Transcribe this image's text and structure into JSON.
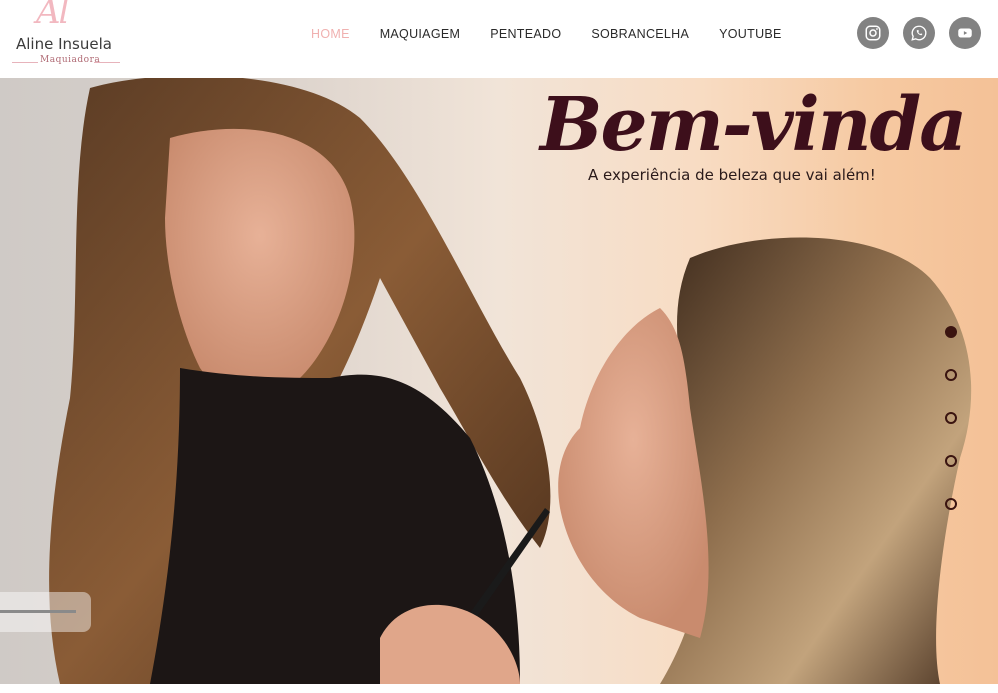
{
  "logo": {
    "mark": "Al",
    "name": "Aline Insuela",
    "subtitle": "Maquiadora"
  },
  "nav": {
    "items": [
      {
        "label": "HOME",
        "active": true
      },
      {
        "label": "MAQUIAGEM",
        "active": false
      },
      {
        "label": "PENTEADO",
        "active": false
      },
      {
        "label": "SOBRANCELHA",
        "active": false
      },
      {
        "label": "YOUTUBE",
        "active": false
      }
    ]
  },
  "socials": [
    "instagram-icon",
    "whatsapp-icon",
    "youtube-icon"
  ],
  "hero": {
    "title": "Bem-vinda",
    "subtitle": "A experiência de beleza que vai além!",
    "slide_count": 5,
    "active_slide": 1
  },
  "colors": {
    "accent": "#f0b1b0",
    "title": "#3d0f1b",
    "social_bg": "#828282"
  }
}
